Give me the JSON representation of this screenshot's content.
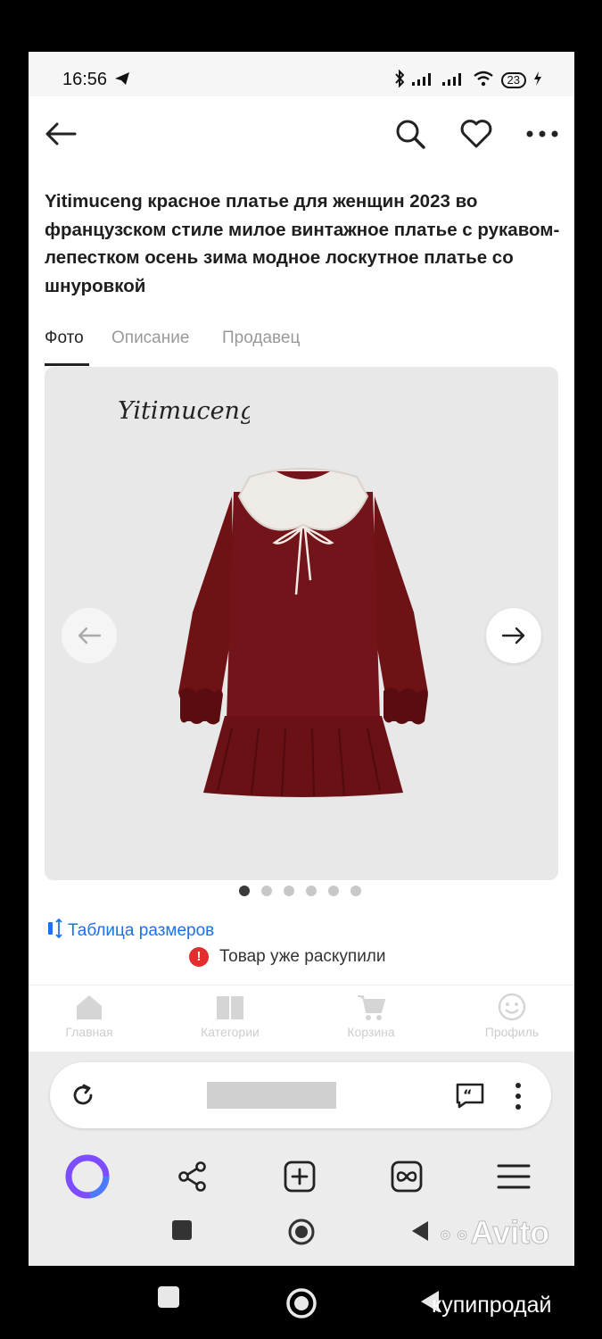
{
  "status_bar": {
    "time": "16:56",
    "battery": "23"
  },
  "appbar": {
    "back_icon": "arrow-left-icon",
    "search_icon": "search-icon",
    "favorite_icon": "heart-icon",
    "more_icon": "more-horizontal-icon"
  },
  "product": {
    "title": "Yitimuceng красное платье для женщин 2023 во французском стиле милое винтажное платье с рукавом-лепестком осень зима модное лоскутное платье со шнуровкой",
    "brand_logo_text": "Yitimuceng"
  },
  "tabs": [
    {
      "label": "Фото",
      "active": true
    },
    {
      "label": "Описание",
      "active": false
    },
    {
      "label": "Продавец",
      "active": false
    }
  ],
  "gallery": {
    "image_count": 6,
    "active_index": 0
  },
  "size_table": {
    "label": "Таблица размеров"
  },
  "stock": {
    "message": "Товар уже раскупили",
    "icon": "exclamation-circle-icon",
    "color": "#e52d2d"
  },
  "bottom_nav": [
    {
      "label": "Главная",
      "icon": "home-icon"
    },
    {
      "label": "Категории",
      "icon": "book-icon"
    },
    {
      "label": "Корзина",
      "icon": "cart-icon"
    },
    {
      "label": "Профиль",
      "icon": "smiley-icon"
    }
  ],
  "browser": {
    "reload_icon": "reload-icon",
    "quote_icon": "quote-icon",
    "menu_icon": "vertical-dots-icon"
  },
  "browser_toolbar": [
    "assistant-icon",
    "share-icon",
    "add-tab-icon",
    "tabs-icon",
    "menu-icon"
  ],
  "watermarks": {
    "avito": "Avito",
    "kupiprodai": "купипродай"
  },
  "colors": {
    "accent_link": "#1a73e8",
    "dress": "#6e1216",
    "alert": "#e52d2d",
    "assistant": "#7b4dff"
  }
}
